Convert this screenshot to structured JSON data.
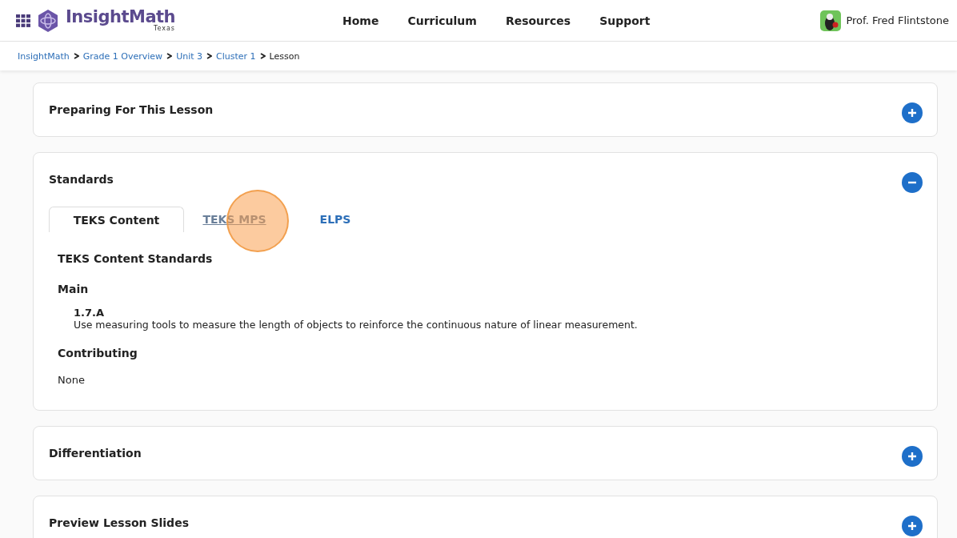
{
  "header": {
    "logo": {
      "name": "InsightMath",
      "sub": "Texas"
    },
    "nav": [
      "Home",
      "Curriculum",
      "Resources",
      "Support"
    ],
    "user": "Prof. Fred Flintstone"
  },
  "breadcrumb": [
    {
      "label": "InsightMath",
      "link": true
    },
    {
      "label": "Grade 1 Overview",
      "link": true
    },
    {
      "label": "Unit 3",
      "link": true
    },
    {
      "label": "Cluster 1",
      "link": true
    },
    {
      "label": "Lesson",
      "link": false
    }
  ],
  "sections": [
    {
      "title": "Preparing For This Lesson",
      "expanded": false
    },
    {
      "title": "Standards",
      "expanded": true,
      "tabs": [
        {
          "label": "TEKS Content",
          "selected": true,
          "hovered": false
        },
        {
          "label": "TEKS MPS",
          "selected": false,
          "hovered": true
        },
        {
          "label": "ELPS",
          "selected": false,
          "hovered": false
        }
      ],
      "content": {
        "heading": "TEKS Content Standards",
        "main_label": "Main",
        "main": [
          {
            "code": "1.7.A",
            "text": "Use measuring tools to measure the length of objects to reinforce the continuous nature of linear measurement."
          }
        ],
        "contributing_label": "Contributing",
        "contributing": "None"
      }
    },
    {
      "title": "Differentiation",
      "expanded": false
    },
    {
      "title": "Preview Lesson Slides",
      "expanded": false
    }
  ]
}
